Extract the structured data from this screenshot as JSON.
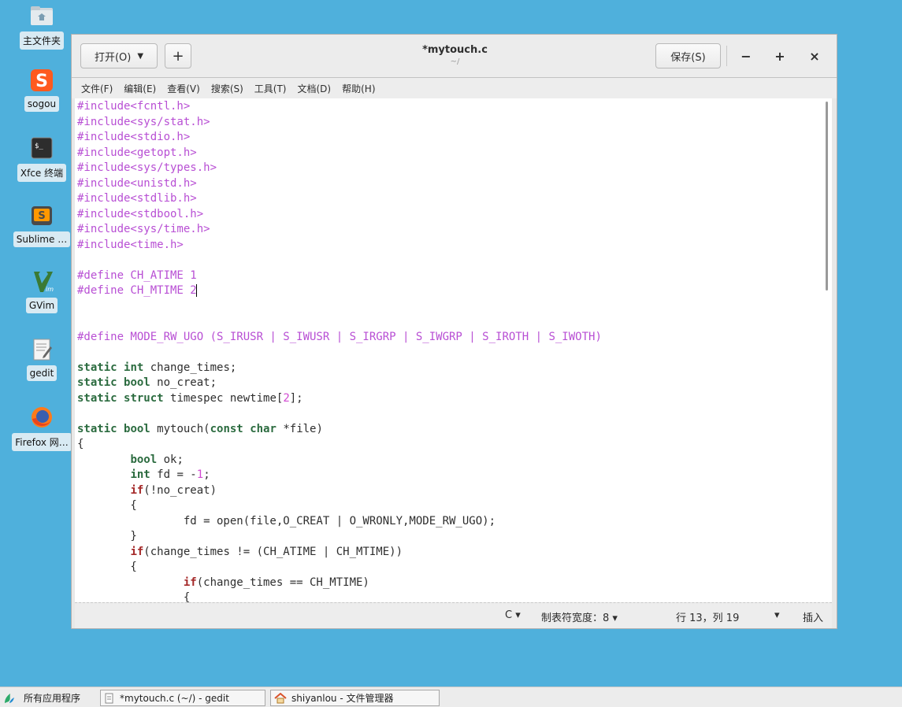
{
  "desktop": {
    "icons": [
      {
        "label": "主文件夹"
      },
      {
        "label": "sogou"
      },
      {
        "label": "Xfce 终端"
      },
      {
        "label": "Sublime …"
      },
      {
        "label": "GVim"
      },
      {
        "label": "gedit"
      },
      {
        "label": "Firefox 网…"
      }
    ]
  },
  "window": {
    "open_label": "打开(O)",
    "new_tab_label": "+",
    "title": "*mytouch.c",
    "subtitle": "~/",
    "save_label": "保存(S)",
    "minimize_label": "−",
    "maximize_label": "+",
    "close_label": "×"
  },
  "menu": [
    "文件(F)",
    "编辑(E)",
    "查看(V)",
    "搜索(S)",
    "工具(T)",
    "文档(D)",
    "帮助(H)"
  ],
  "status": {
    "language": "C ▾",
    "tab_width": "制表符宽度：8 ▾",
    "position": "行 13，列 19",
    "position_dropdown": "▾",
    "mode": "插入"
  },
  "taskbar": {
    "apps_label": "所有应用程序",
    "tasks": [
      {
        "label": "*mytouch.c (~/) - gedit"
      },
      {
        "label": "shiyanlou - 文件管理器"
      }
    ]
  },
  "colors": {
    "desktop": "#4fb0dc",
    "preprocessor": "#b84fd4",
    "type_keyword": "#2b6b3f",
    "control_keyword": "#a52a2a",
    "number": "#d24bd2"
  }
}
